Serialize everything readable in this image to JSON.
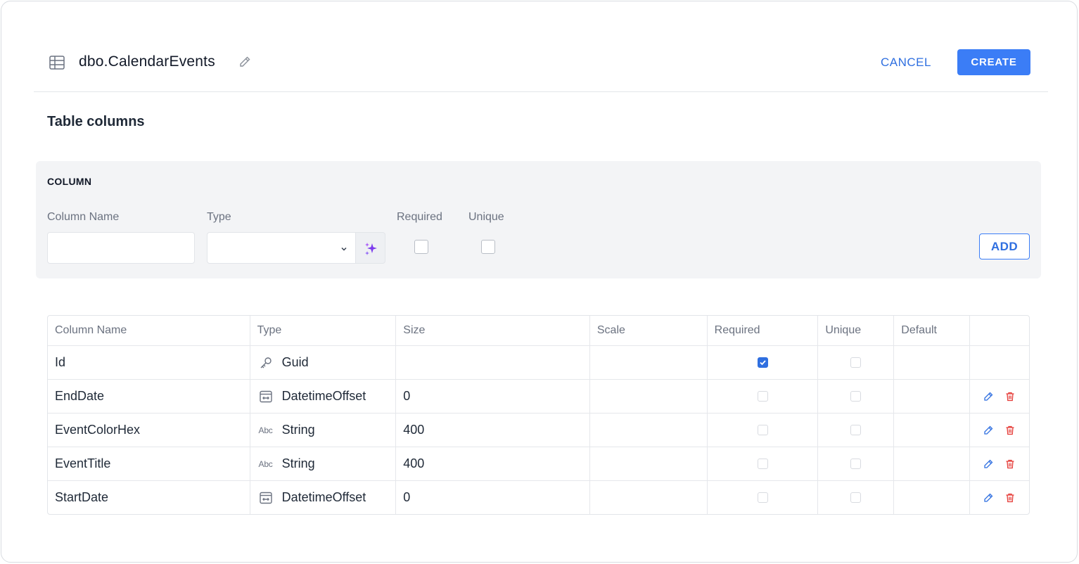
{
  "header": {
    "table_name": "dbo.CalendarEvents",
    "cancel_label": "CANCEL",
    "create_label": "CREATE"
  },
  "section": {
    "title": "Table columns"
  },
  "add_panel": {
    "heading": "COLUMN",
    "column_name_label": "Column Name",
    "column_name_value": "",
    "type_label": "Type",
    "type_value": "",
    "required_label": "Required",
    "required_checked": false,
    "unique_label": "Unique",
    "unique_checked": false,
    "add_label": "ADD"
  },
  "table": {
    "headers": [
      "Column Name",
      "Type",
      "Size",
      "Scale",
      "Required",
      "Unique",
      "Default",
      ""
    ],
    "rows": [
      {
        "name": "Id",
        "type_icon": "key-icon",
        "type": "Guid",
        "size": "",
        "scale": "",
        "required": true,
        "unique": false,
        "default": "",
        "editable": false
      },
      {
        "name": "EndDate",
        "type_icon": "datetime-icon",
        "type": "DatetimeOffset",
        "size": "0",
        "scale": "",
        "required": false,
        "unique": false,
        "default": "",
        "editable": true
      },
      {
        "name": "EventColorHex",
        "type_icon": "abc-icon",
        "type": "String",
        "size": "400",
        "scale": "",
        "required": false,
        "unique": false,
        "default": "",
        "editable": true
      },
      {
        "name": "EventTitle",
        "type_icon": "abc-icon",
        "type": "String",
        "size": "400",
        "scale": "",
        "required": false,
        "unique": false,
        "default": "",
        "editable": true
      },
      {
        "name": "StartDate",
        "type_icon": "datetime-icon",
        "type": "DatetimeOffset",
        "size": "0",
        "scale": "",
        "required": false,
        "unique": false,
        "default": "",
        "editable": true
      }
    ]
  },
  "icons": {
    "abc_text": "Abc"
  },
  "colors": {
    "primary": "#3b7df6",
    "link": "#2f6fe0",
    "danger": "#e53935",
    "magic": "#7c3aed"
  }
}
